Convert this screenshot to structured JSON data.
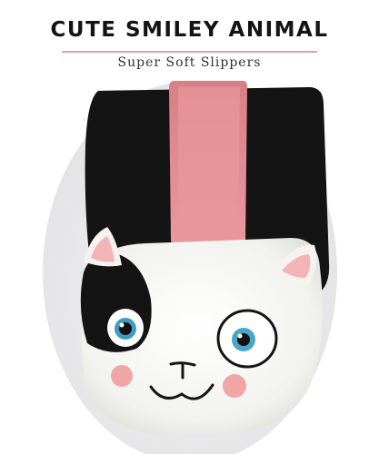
{
  "header": {
    "title": "CUTE SMILEY ANIMAL",
    "subtitle": "Super Soft Slippers"
  },
  "image": {
    "subject": "slipper-photo",
    "colors": {
      "accent_divider": "#d9a3a6",
      "background": "#ffffff",
      "backdrop": "#ececee",
      "slipper_black": "#151515",
      "slipper_white": "#f6f6f4",
      "lining_pink": "#e58f95",
      "cheek_pink": "#f0a6a6",
      "eye_blue": "#4aa6c6"
    }
  }
}
